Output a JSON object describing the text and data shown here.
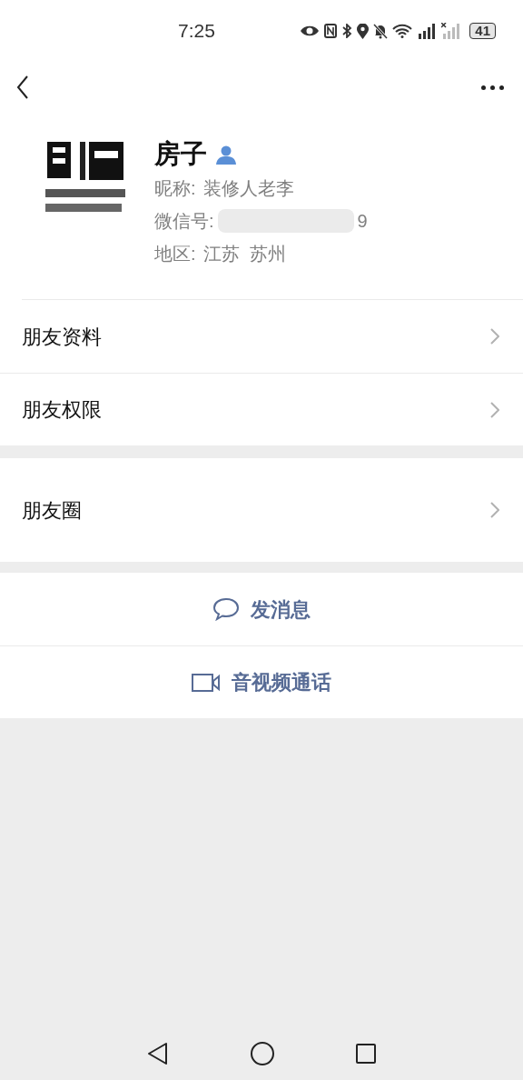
{
  "status_bar": {
    "time": "7:25",
    "battery": "41"
  },
  "profile": {
    "name": "房子",
    "nickname_label": "昵称:",
    "nickname": "装修人老李",
    "wechat_id_label": "微信号:",
    "wechat_id_visible": "9",
    "region_label": "地区:",
    "region": "江苏  苏州"
  },
  "menu_groups": [
    [
      {
        "label": "朋友资料"
      },
      {
        "label": "朋友权限"
      }
    ],
    [
      {
        "label": "朋友圈"
      }
    ]
  ],
  "actions": [
    {
      "kind": "message",
      "label": "发消息"
    },
    {
      "kind": "call",
      "label": "音视频通话"
    }
  ]
}
